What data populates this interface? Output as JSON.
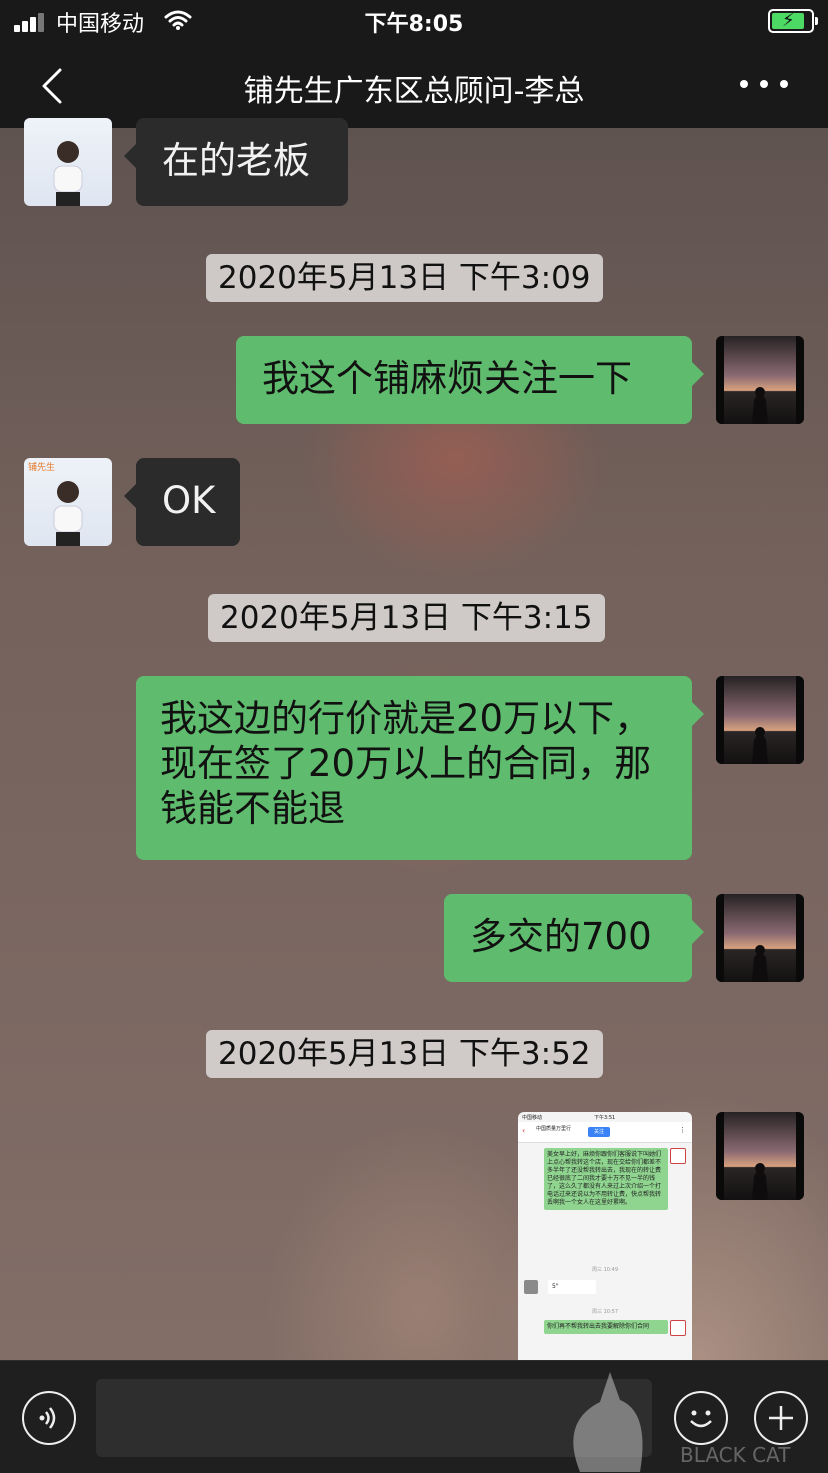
{
  "status_bar": {
    "carrier": "中国移动",
    "time": "下午8:05",
    "battery_percent": 90
  },
  "header": {
    "back_icon": "chevron-left-icon",
    "title": "铺先生广东区总顾问-李总",
    "more_icon": "more-dots-icon"
  },
  "messages": [
    {
      "side": "in",
      "text": "在的老板"
    },
    {
      "type": "timestamp",
      "text": "2020年5月13日 下午3:09"
    },
    {
      "side": "out",
      "text": "我这个铺麻烦关注一下"
    },
    {
      "side": "in",
      "text": "OK"
    },
    {
      "type": "timestamp",
      "text": "2020年5月13日 下午3:15"
    },
    {
      "side": "out",
      "text": "我这边的行价就是20万以下，现在签了20万以上的合同，那钱能不能退"
    },
    {
      "side": "out",
      "text": "多交的700"
    },
    {
      "type": "timestamp",
      "text": "2020年5月13日 下午3:52"
    }
  ],
  "agent_avatar_brand": "铺先生",
  "image_message": {
    "status_left": "中国移动",
    "status_time": "下午3:51",
    "app_name": "中国质量万里行",
    "follow_label": "关注",
    "text1": "美女早上好，麻烦你跟你们客服说下叫她们上点心帮我转这个店，现在交给你们都差不多半年了还没帮我转出去，我现在的转让费已经很底了二间我才要十万不见一半的钱了，这么久了都没有人来过上次介绍一个打电话过来还说以为不用转让费，快点帮我转丢啊我一个女人在这里好累啊。",
    "time1": "周三 10:49",
    "voice": "5\"",
    "time2": "周三 10:57",
    "text2": "你们再不帮我转出去我要解除你们合同"
  },
  "input_bar": {
    "voice_icon": "voice-icon",
    "emoji_icon": "emoji-icon",
    "plus_icon": "plus-icon"
  },
  "watermark": {
    "text": "BLACK CAT"
  }
}
